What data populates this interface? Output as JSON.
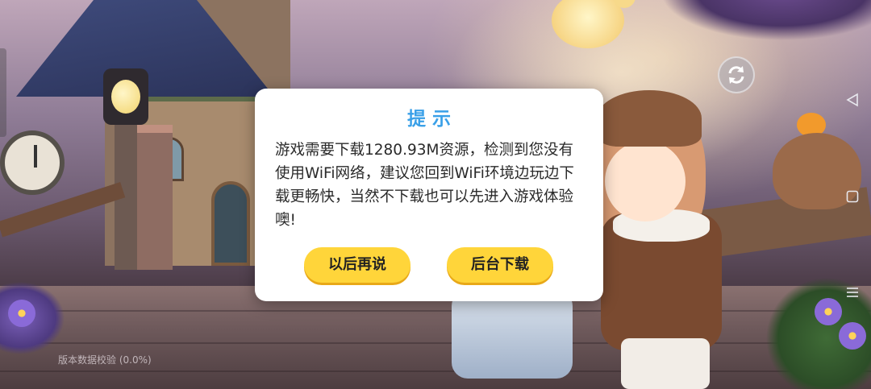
{
  "dialog": {
    "title": "提示",
    "message": "游戏需要下载1280.93M资源，检测到您没有使用WiFi网络，建议您回到WiFi环境边玩边下载更畅快，当然不下载也可以先进入游戏体验噢!",
    "buttons": {
      "later_label": "以后再说",
      "background_download_label": "后台下载"
    }
  },
  "status": {
    "text": "版本数据校验 (0.0%)",
    "progress_percent": 0.0
  },
  "overlay": {
    "refresh_icon": "refresh-icon"
  },
  "system_nav": {
    "back_icon": "back-triangle-icon",
    "home_icon": "home-square-icon",
    "menu_icon": "menu-lines-icon"
  },
  "colors": {
    "title_blue": "#3aa0e8",
    "button_yellow": "#ffd53a",
    "dialog_bg": "#ffffff"
  }
}
